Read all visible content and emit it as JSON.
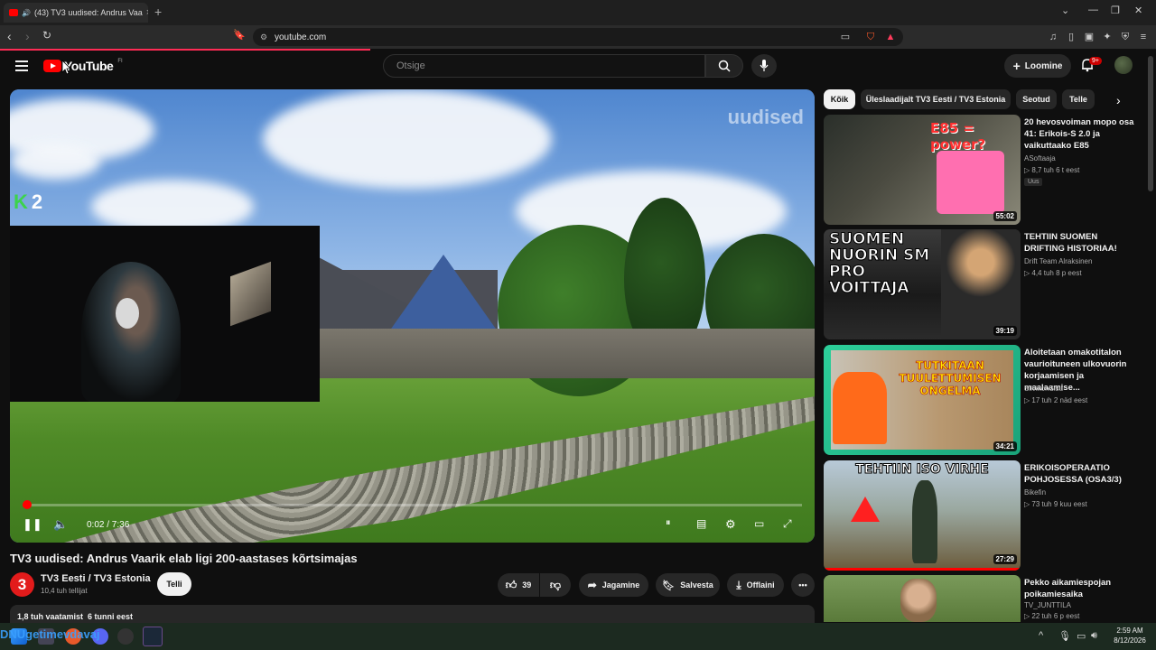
{
  "browser": {
    "tab_title": "(43) TV3 uudised: Andrus Vaa",
    "url": "youtube.com",
    "new_tab_symbol": "+"
  },
  "youtube": {
    "logo_text": "YouTube",
    "region": "FI",
    "search_placeholder": "Otsige",
    "create_label": "Loomine",
    "notif_count": "9+"
  },
  "player": {
    "watermark": "uudised",
    "channel_bug": "2",
    "time": "0:02 / 7:36",
    "progress_fraction": 0.004
  },
  "video": {
    "title": "TV3 uudised: Andrus Vaarik elab ligi 200-aastases kõrtsimajas",
    "channel": "TV3 Eesti / TV3 Estonia",
    "channel_logo": "3",
    "subscribers": "10,4 tuh tellijat",
    "subscribe_label": "Telli",
    "likes": "39",
    "share_label": "Jagamine",
    "save_label": "Salvesta",
    "download_label": "Offlaini",
    "views_line": "1,8 tuh vaatamist  6 tunni eest"
  },
  "chips": [
    "Kõik",
    "Üleslaadijalt TV3 Eesti / TV3 Estonia",
    "Seotud",
    "Telle"
  ],
  "recommendations": [
    {
      "title": "20 hevosvoiman mopo osa 41: Erikois-S 2.0 ja vaikuttaako E85",
      "channel": "ASoftaaja",
      "views": "8,7 tuh",
      "age": "6 t eest",
      "badge": "Uus",
      "duration": "55:02",
      "thumb_text": "E85 = power?"
    },
    {
      "title": "TEHTIIN SUOMEN DRIFTING HISTORIAA!",
      "channel": "Drift Team Alraksinen",
      "views": "4,4 tuh",
      "age": "8 p eest",
      "duration": "39:19",
      "thumb_text": "SUOMEN NUORIN SM PRO VOITTAJA"
    },
    {
      "title": "Aloitetaan omakotitalon vaurioituneen ulkovuorin korjaamisen ja maalaamise...",
      "channel": "SilvikonSisu",
      "views": "17 tuh",
      "age": "2 näd eest",
      "duration": "34:21",
      "thumb_text": "TUTKITAAN TUULETTUMISEN ONGELMA"
    },
    {
      "title": "ERIKOISOPERAATIO POHJOSESSA (OSA3/3)",
      "channel": "Bikefin",
      "views": "73 tuh",
      "age": "9 kuu eest",
      "duration": "27:29",
      "thumb_text": "TEHTIIN ISO VIRHE"
    },
    {
      "title": "Pekko aikamiespojan poikamiesaika",
      "channel": "TV_JUNTTILA",
      "views": "22 tuh",
      "age": "6 p eest"
    }
  ],
  "taskbar": {
    "overlay_text": "DNUgetimevdavaj",
    "time": "2:59 AM",
    "date": "8/12/2026"
  }
}
